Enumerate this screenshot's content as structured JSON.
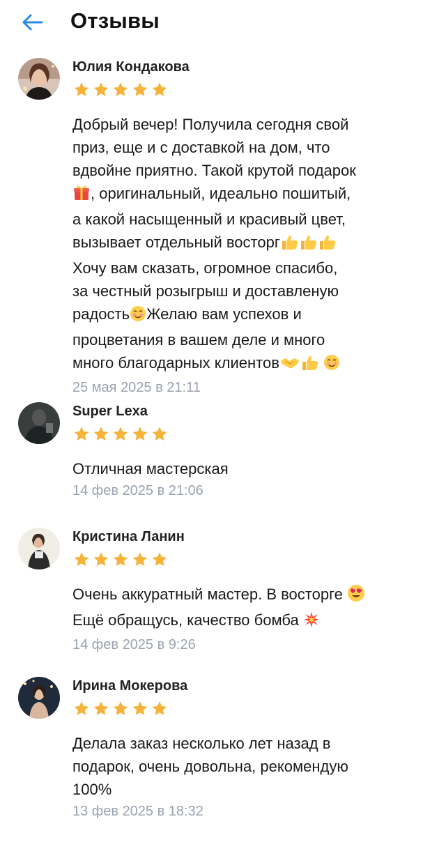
{
  "header": {
    "title": "Отзывы"
  },
  "reviews": [
    {
      "author": "Юлия Кондакова",
      "rating": 5,
      "lines": [
        "Добрый вечер! Получила сегодня свой",
        "приз, еще и с доставкой на дом, что",
        "вдвойне приятно. Такой крутой подарок",
        ", оригинальный, идеально пошитый,",
        "а какой насыщенный и красивый цвет,",
        "вызывает отдельный восторг",
        "Хочу вам сказать, огромное спасибо,",
        "за честный розыгрыш и доставленую",
        "радость",
        "Желаю вам успехов и",
        "процветания в вашем деле и много",
        "много благодарных клиентов"
      ],
      "date": "25 мая 2025 в 21:11"
    },
    {
      "author": "Super Lexa",
      "rating": 5,
      "lines": [
        "Отличная мастерская"
      ],
      "date": "14 фев 2025 в 21:06"
    },
    {
      "author": "Кристина Ланин",
      "rating": 5,
      "lines": [
        "Очень аккуратный мастер. В восторге",
        "Ещё обращусь, качество бомба"
      ],
      "date": "14 фев 2025 в 9:26"
    },
    {
      "author": "Ирина Мокерова",
      "rating": 5,
      "lines": [
        "Делала заказ несколько лет назад в",
        "подарок, очень довольна, рекомендую",
        "100%"
      ],
      "date": "13 фев 2025 в 18:32"
    }
  ],
  "colors": {
    "accent": "#2688eb",
    "star": "#f6b33c",
    "date": "#9aa3ae"
  }
}
